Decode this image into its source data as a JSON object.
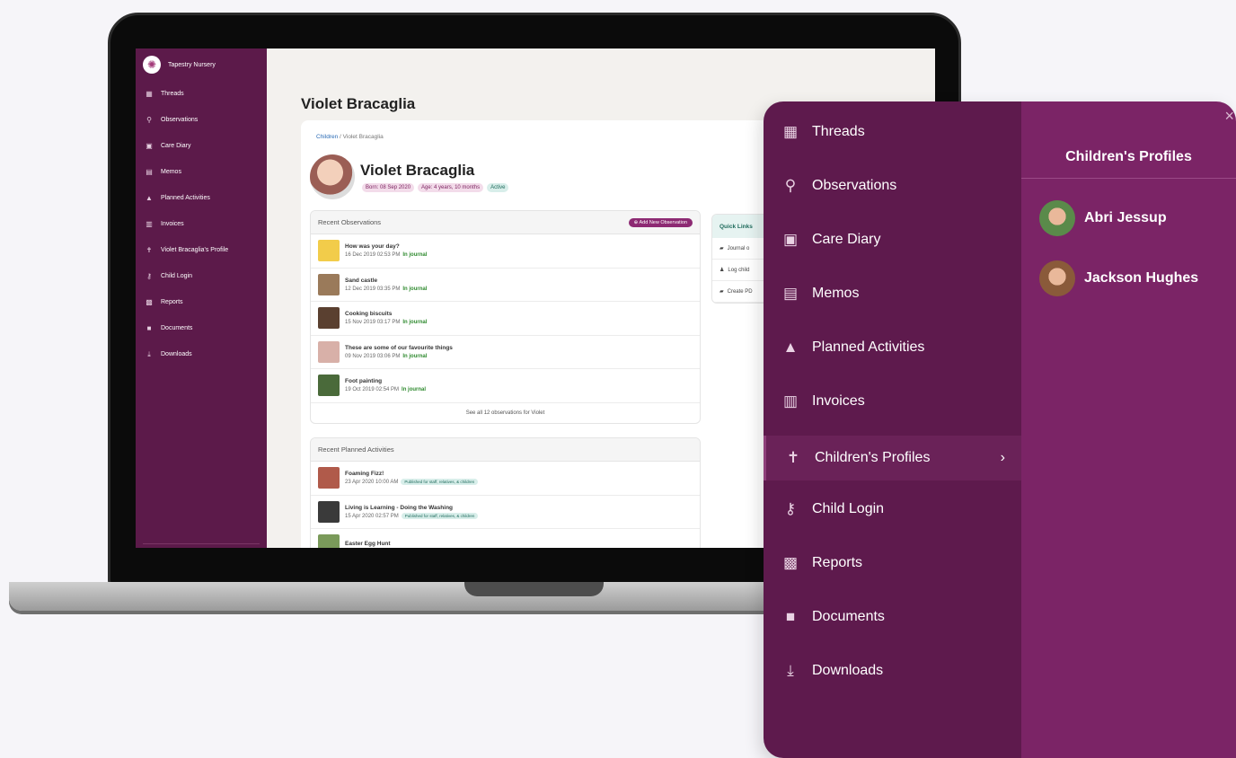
{
  "screen": {
    "brand": "Tapestry Nursery",
    "sidebar": [
      {
        "icon": "threads-icon",
        "glyph": "▦",
        "label": "Threads"
      },
      {
        "icon": "search-icon",
        "glyph": "⚲",
        "label": "Observations"
      },
      {
        "icon": "care-diary-icon",
        "glyph": "▣",
        "label": "Care Diary"
      },
      {
        "icon": "memo-icon",
        "glyph": "▤",
        "label": "Memos"
      },
      {
        "icon": "planned-activities-icon",
        "glyph": "▲",
        "label": "Planned Activities"
      },
      {
        "icon": "invoice-icon",
        "glyph": "▥",
        "label": "Invoices"
      },
      {
        "icon": "profile-icon",
        "glyph": "✝",
        "label": "Violet Bracaglia's Profile"
      },
      {
        "icon": "key-icon",
        "glyph": "⚷",
        "label": "Child Login"
      },
      {
        "icon": "reports-icon",
        "glyph": "▩",
        "label": "Reports"
      },
      {
        "icon": "folder-icon",
        "glyph": "■",
        "label": "Documents"
      },
      {
        "icon": "download-icon",
        "glyph": "⤓",
        "label": "Downloads"
      }
    ],
    "page_title": "Violet Bracaglia",
    "breadcrumb": {
      "link": "Children",
      "sep": "/",
      "current": "Violet Bracaglia"
    },
    "child": {
      "name": "Violet Bracaglia",
      "born": "Born: 08 Sep 2020",
      "age": "Age: 4 years, 10 months",
      "status": "Active"
    },
    "observations": {
      "title": "Recent Observations",
      "add_label": "Add New Observation",
      "items": [
        {
          "title": "How was your day?",
          "date": "16 Dec 2019 02:53 PM",
          "tag": "In journal",
          "color": "#f2cc4a"
        },
        {
          "title": "Sand castle",
          "date": "12 Dec 2019 03:35 PM",
          "tag": "In journal",
          "color": "#9a7a5a"
        },
        {
          "title": "Cooking biscuits",
          "date": "15 Nov 2019 03:17 PM",
          "tag": "In journal",
          "color": "#5a4030"
        },
        {
          "title": "These are some of our favourite things",
          "date": "09 Nov 2019 03:06 PM",
          "tag": "In journal",
          "color": "#d8b0a8"
        },
        {
          "title": "Foot painting",
          "date": "19 Oct 2019 02:54 PM",
          "tag": "In journal",
          "color": "#4a6a3a"
        }
      ],
      "see_all": "See all 12 observations for Violet"
    },
    "planned": {
      "title": "Recent Planned Activities",
      "items": [
        {
          "title": "Foaming Fizz!",
          "date": "23 Apr 2020 10:00 AM",
          "tag": "Published for staff, relatives, & children",
          "color": "#b05a4a"
        },
        {
          "title": "Living is Learning - Doing the Washing",
          "date": "15 Apr 2020 02:57 PM",
          "tag": "Published for staff, relatives, & children",
          "color": "#3a3a3a"
        },
        {
          "title": "Easter Egg Hunt",
          "date": "",
          "tag": "",
          "color": "#7a9a5a"
        }
      ]
    },
    "quick_links": {
      "title": "Quick Links",
      "items": [
        {
          "glyph": "▰",
          "label": "Journal o"
        },
        {
          "glyph": "♟",
          "label": "Log child"
        },
        {
          "glyph": "▰",
          "label": "Create PD"
        }
      ]
    }
  },
  "menu": {
    "items": [
      {
        "icon": "threads-icon",
        "glyph": "▦",
        "label": "Threads"
      },
      {
        "icon": "search-icon",
        "glyph": "⚲",
        "label": "Observations"
      },
      {
        "icon": "care-diary-icon",
        "glyph": "▣",
        "label": "Care Diary"
      },
      {
        "icon": "memo-icon",
        "glyph": "▤",
        "label": "Memos"
      },
      {
        "icon": "planned-activities-icon",
        "glyph": "▲",
        "label": "Planned Activities"
      },
      {
        "icon": "invoice-icon",
        "glyph": "▥",
        "label": "Invoices"
      },
      {
        "icon": "child-profile-icon",
        "glyph": "✝",
        "label": "Children's Profiles",
        "active": true
      },
      {
        "icon": "key-icon",
        "glyph": "⚷",
        "label": "Child Login"
      },
      {
        "icon": "reports-icon",
        "glyph": "▩",
        "label": "Reports"
      },
      {
        "icon": "folder-icon",
        "glyph": "■",
        "label": "Documents"
      },
      {
        "icon": "download-icon",
        "glyph": "⤓",
        "label": "Downloads"
      }
    ],
    "chevron": "›",
    "submenu_title": "Children's Profiles",
    "close": "×",
    "profiles": [
      {
        "name": "Abri Jessup",
        "color": "#5a8a4a"
      },
      {
        "name": "Jackson Hughes",
        "color": "#8a5a3a"
      }
    ]
  }
}
